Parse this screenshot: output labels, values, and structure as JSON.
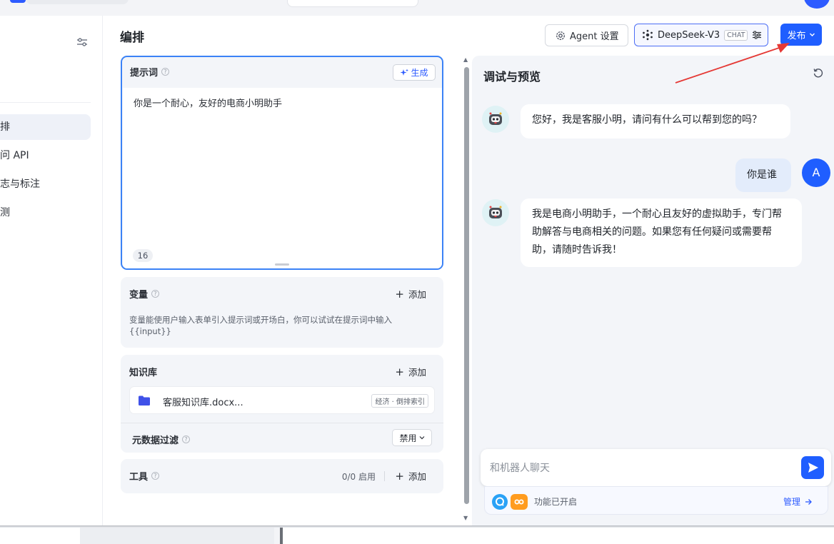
{
  "nav": {
    "items": [
      {
        "label": "排",
        "active": true
      },
      {
        "label": "问 API",
        "active": false
      },
      {
        "label": "志与标注",
        "active": false
      },
      {
        "label": "测",
        "active": false
      }
    ]
  },
  "header": {
    "title": "编排",
    "agent_settings_label": "Agent 设置",
    "model_name": "DeepSeek-V3",
    "model_tag": "CHAT",
    "publish_label": "发布"
  },
  "prompt": {
    "title": "提示词",
    "generate_label": "生成",
    "text": "你是一个耐心，友好的电商小明助手",
    "char_count": "16"
  },
  "variables": {
    "title": "变量",
    "add_label": "添加",
    "description": "变量能使用户输入表单引入提示词或开场白，你可以试试在提示词中输入 {{input}}"
  },
  "knowledge": {
    "title": "知识库",
    "add_label": "添加",
    "item_name": "客服知识库.docx...",
    "item_tag": "经济 · 倒排索引",
    "metadata_filter_label": "元数据过滤",
    "metadata_filter_value": "禁用"
  },
  "tools": {
    "title": "工具",
    "count": "0/0 启用",
    "add_label": "添加"
  },
  "preview": {
    "title": "调试与预览",
    "messages": [
      {
        "role": "bot",
        "text": "您好，我是客服小明，请问有什么可以帮到您的吗？"
      },
      {
        "role": "user",
        "text": "你是谁"
      },
      {
        "role": "bot",
        "text": "我是电商小明助手，一个耐心且友好的虚拟助手，专门帮助解答与电商相关的问题。如果您有任何疑问或需要帮助，请随时告诉我！"
      }
    ],
    "user_avatar_letter": "A",
    "input_placeholder": "和机器人聊天",
    "features_text": "功能已开启",
    "manage_label": "管理"
  },
  "colors": {
    "accent": "#1f5eff",
    "annotation_arrow": "#e53935"
  }
}
